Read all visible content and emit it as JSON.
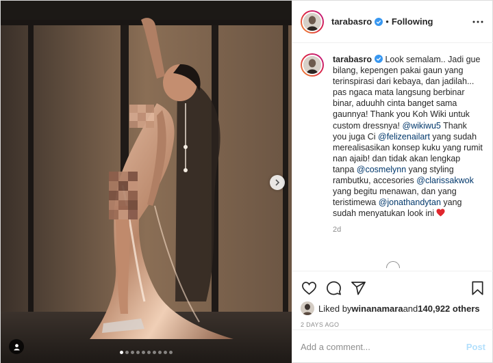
{
  "header": {
    "username": "tarabasro",
    "separator": "•",
    "follow_status": "Following",
    "icons": {
      "verified": "verified-badge-icon",
      "more": "more-options-icon"
    }
  },
  "caption": {
    "username": "tarabasro",
    "part1": " Look semalam.. Jadi gue bilang, kepengen pakai gaun yang terinspirasi dari kebaya, dan jadilah... pas ngaca mata langsung berbinar binar, aduuhh cinta banget sama gaunnya! Thank you Koh Wiki untuk custom dressnya! ",
    "mention1": "@wikiwu5",
    "part2": " Thank you juga Ci ",
    "mention2": "@felizenailart",
    "part3": " yang sudah merealisasikan konsep kuku yang rumit nan ajaib! dan tidak akan lengkap tanpa ",
    "mention3": "@cosmelynn",
    "part4": " yang styling rambutku, accesories ",
    "mention4": "@clarissakwok",
    "part5": " yang begitu menawan, dan yang teristimewa ",
    "mention5": "@jonathandytan",
    "part6": " yang sudah menyatukan look ini ",
    "emoji": "red-heart-emoji",
    "time": "2d"
  },
  "actions": {
    "icons": [
      "heart-icon",
      "comment-icon",
      "share-icon",
      "bookmark-icon"
    ]
  },
  "likes": {
    "prefix": "Liked by ",
    "user": "winanamara",
    "middle": " and ",
    "count": "140,922 others"
  },
  "post_date": "2 DAYS AGO",
  "comment_box": {
    "placeholder": "Add a comment...",
    "post_label": "Post"
  },
  "carousel": {
    "total": 10,
    "active_index": 0
  },
  "colors": {
    "link": "#00376b",
    "muted": "#8e8e8e",
    "post_disabled": "#b2dffc",
    "verified": "#3897f0",
    "heart": "#ed4956"
  }
}
